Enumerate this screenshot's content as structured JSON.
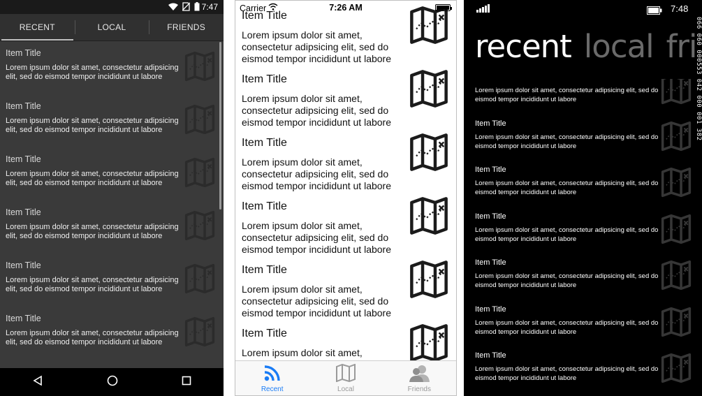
{
  "lorem": "Lorem ipsum dolor sit amet, consectetur adipsicing elit, sed do eismod tempor incididunt ut labore",
  "item_title": "Item Title",
  "icons": {
    "thumbnail": "folded-map-icon"
  },
  "android": {
    "status": {
      "time": "7:47"
    },
    "tabs": [
      "RECENT",
      "LOCAL",
      "FRIENDS"
    ],
    "active_tab": "RECENT",
    "list": {
      "count": 6
    },
    "nav": [
      "back-icon",
      "home-icon",
      "recents-icon"
    ],
    "colors": {
      "background": "#3a3a3a",
      "tabbar": "#303030"
    }
  },
  "ios": {
    "status": {
      "carrier": "Carrier",
      "time": "7:26 AM"
    },
    "list": {
      "count": 6
    },
    "tabbar": [
      {
        "label": "Recent",
        "icon": "rss-feed-icon",
        "active": true
      },
      {
        "label": "Local",
        "icon": "map-icon",
        "active": false
      },
      {
        "label": "Friends",
        "icon": "people-icon",
        "active": false
      }
    ],
    "colors": {
      "accent": "#1a7cf5"
    }
  },
  "windows_phone": {
    "status": {
      "time": "7:48"
    },
    "pivots": {
      "active": "recent",
      "inactive": [
        "local",
        "fri"
      ]
    },
    "list": {
      "count": 7
    },
    "debug_counter": "066 060 000553 042 000 001 382",
    "colors": {
      "background": "#000000",
      "inactive_pivot": "#6a6a6a"
    }
  }
}
